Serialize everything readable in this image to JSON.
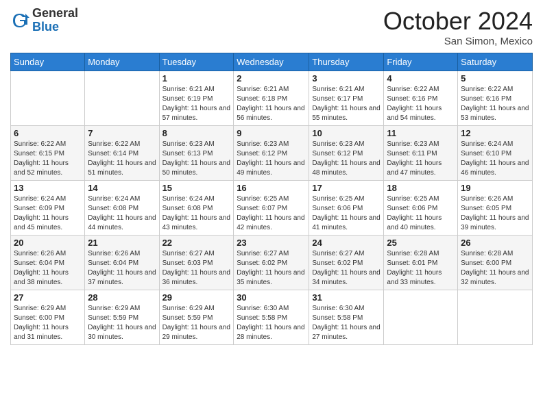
{
  "header": {
    "logo_general": "General",
    "logo_blue": "Blue",
    "month_title": "October 2024",
    "location": "San Simon, Mexico"
  },
  "weekdays": [
    "Sunday",
    "Monday",
    "Tuesday",
    "Wednesday",
    "Thursday",
    "Friday",
    "Saturday"
  ],
  "weeks": [
    [
      {
        "day": "",
        "sunrise": "",
        "sunset": "",
        "daylight": ""
      },
      {
        "day": "",
        "sunrise": "",
        "sunset": "",
        "daylight": ""
      },
      {
        "day": "1",
        "sunrise": "Sunrise: 6:21 AM",
        "sunset": "Sunset: 6:19 PM",
        "daylight": "Daylight: 11 hours and 57 minutes."
      },
      {
        "day": "2",
        "sunrise": "Sunrise: 6:21 AM",
        "sunset": "Sunset: 6:18 PM",
        "daylight": "Daylight: 11 hours and 56 minutes."
      },
      {
        "day": "3",
        "sunrise": "Sunrise: 6:21 AM",
        "sunset": "Sunset: 6:17 PM",
        "daylight": "Daylight: 11 hours and 55 minutes."
      },
      {
        "day": "4",
        "sunrise": "Sunrise: 6:22 AM",
        "sunset": "Sunset: 6:16 PM",
        "daylight": "Daylight: 11 hours and 54 minutes."
      },
      {
        "day": "5",
        "sunrise": "Sunrise: 6:22 AM",
        "sunset": "Sunset: 6:16 PM",
        "daylight": "Daylight: 11 hours and 53 minutes."
      }
    ],
    [
      {
        "day": "6",
        "sunrise": "Sunrise: 6:22 AM",
        "sunset": "Sunset: 6:15 PM",
        "daylight": "Daylight: 11 hours and 52 minutes."
      },
      {
        "day": "7",
        "sunrise": "Sunrise: 6:22 AM",
        "sunset": "Sunset: 6:14 PM",
        "daylight": "Daylight: 11 hours and 51 minutes."
      },
      {
        "day": "8",
        "sunrise": "Sunrise: 6:23 AM",
        "sunset": "Sunset: 6:13 PM",
        "daylight": "Daylight: 11 hours and 50 minutes."
      },
      {
        "day": "9",
        "sunrise": "Sunrise: 6:23 AM",
        "sunset": "Sunset: 6:12 PM",
        "daylight": "Daylight: 11 hours and 49 minutes."
      },
      {
        "day": "10",
        "sunrise": "Sunrise: 6:23 AM",
        "sunset": "Sunset: 6:12 PM",
        "daylight": "Daylight: 11 hours and 48 minutes."
      },
      {
        "day": "11",
        "sunrise": "Sunrise: 6:23 AM",
        "sunset": "Sunset: 6:11 PM",
        "daylight": "Daylight: 11 hours and 47 minutes."
      },
      {
        "day": "12",
        "sunrise": "Sunrise: 6:24 AM",
        "sunset": "Sunset: 6:10 PM",
        "daylight": "Daylight: 11 hours and 46 minutes."
      }
    ],
    [
      {
        "day": "13",
        "sunrise": "Sunrise: 6:24 AM",
        "sunset": "Sunset: 6:09 PM",
        "daylight": "Daylight: 11 hours and 45 minutes."
      },
      {
        "day": "14",
        "sunrise": "Sunrise: 6:24 AM",
        "sunset": "Sunset: 6:08 PM",
        "daylight": "Daylight: 11 hours and 44 minutes."
      },
      {
        "day": "15",
        "sunrise": "Sunrise: 6:24 AM",
        "sunset": "Sunset: 6:08 PM",
        "daylight": "Daylight: 11 hours and 43 minutes."
      },
      {
        "day": "16",
        "sunrise": "Sunrise: 6:25 AM",
        "sunset": "Sunset: 6:07 PM",
        "daylight": "Daylight: 11 hours and 42 minutes."
      },
      {
        "day": "17",
        "sunrise": "Sunrise: 6:25 AM",
        "sunset": "Sunset: 6:06 PM",
        "daylight": "Daylight: 11 hours and 41 minutes."
      },
      {
        "day": "18",
        "sunrise": "Sunrise: 6:25 AM",
        "sunset": "Sunset: 6:06 PM",
        "daylight": "Daylight: 11 hours and 40 minutes."
      },
      {
        "day": "19",
        "sunrise": "Sunrise: 6:26 AM",
        "sunset": "Sunset: 6:05 PM",
        "daylight": "Daylight: 11 hours and 39 minutes."
      }
    ],
    [
      {
        "day": "20",
        "sunrise": "Sunrise: 6:26 AM",
        "sunset": "Sunset: 6:04 PM",
        "daylight": "Daylight: 11 hours and 38 minutes."
      },
      {
        "day": "21",
        "sunrise": "Sunrise: 6:26 AM",
        "sunset": "Sunset: 6:04 PM",
        "daylight": "Daylight: 11 hours and 37 minutes."
      },
      {
        "day": "22",
        "sunrise": "Sunrise: 6:27 AM",
        "sunset": "Sunset: 6:03 PM",
        "daylight": "Daylight: 11 hours and 36 minutes."
      },
      {
        "day": "23",
        "sunrise": "Sunrise: 6:27 AM",
        "sunset": "Sunset: 6:02 PM",
        "daylight": "Daylight: 11 hours and 35 minutes."
      },
      {
        "day": "24",
        "sunrise": "Sunrise: 6:27 AM",
        "sunset": "Sunset: 6:02 PM",
        "daylight": "Daylight: 11 hours and 34 minutes."
      },
      {
        "day": "25",
        "sunrise": "Sunrise: 6:28 AM",
        "sunset": "Sunset: 6:01 PM",
        "daylight": "Daylight: 11 hours and 33 minutes."
      },
      {
        "day": "26",
        "sunrise": "Sunrise: 6:28 AM",
        "sunset": "Sunset: 6:00 PM",
        "daylight": "Daylight: 11 hours and 32 minutes."
      }
    ],
    [
      {
        "day": "27",
        "sunrise": "Sunrise: 6:29 AM",
        "sunset": "Sunset: 6:00 PM",
        "daylight": "Daylight: 11 hours and 31 minutes."
      },
      {
        "day": "28",
        "sunrise": "Sunrise: 6:29 AM",
        "sunset": "Sunset: 5:59 PM",
        "daylight": "Daylight: 11 hours and 30 minutes."
      },
      {
        "day": "29",
        "sunrise": "Sunrise: 6:29 AM",
        "sunset": "Sunset: 5:59 PM",
        "daylight": "Daylight: 11 hours and 29 minutes."
      },
      {
        "day": "30",
        "sunrise": "Sunrise: 6:30 AM",
        "sunset": "Sunset: 5:58 PM",
        "daylight": "Daylight: 11 hours and 28 minutes."
      },
      {
        "day": "31",
        "sunrise": "Sunrise: 6:30 AM",
        "sunset": "Sunset: 5:58 PM",
        "daylight": "Daylight: 11 hours and 27 minutes."
      },
      {
        "day": "",
        "sunrise": "",
        "sunset": "",
        "daylight": ""
      },
      {
        "day": "",
        "sunrise": "",
        "sunset": "",
        "daylight": ""
      }
    ]
  ]
}
